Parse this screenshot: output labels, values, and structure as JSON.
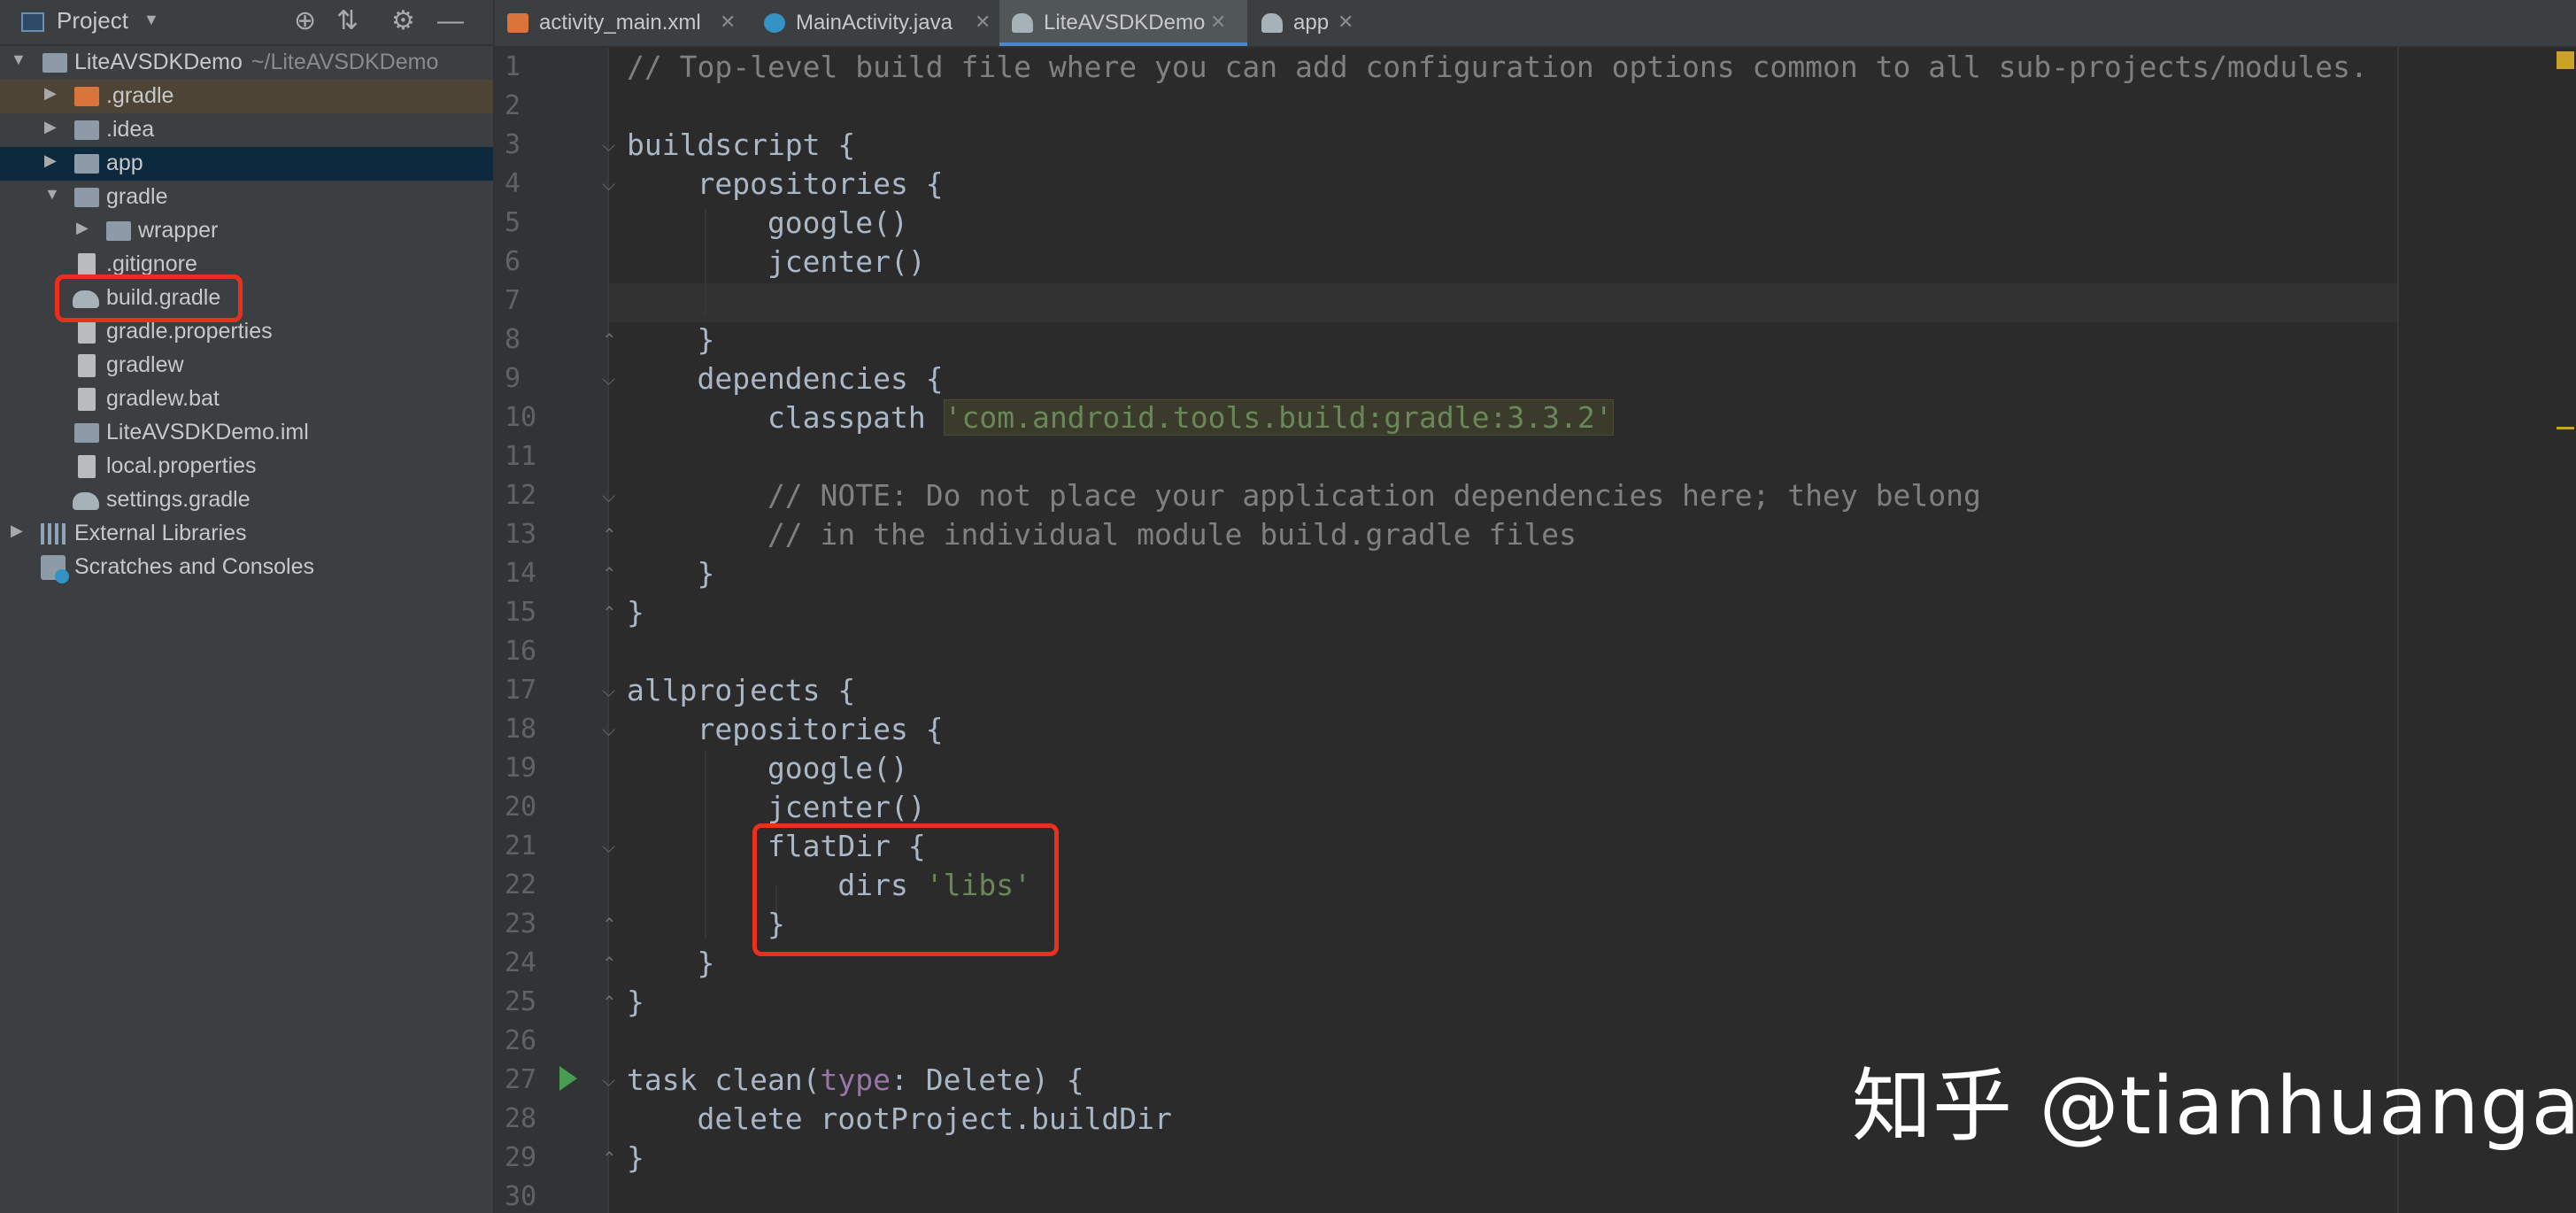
{
  "project_panel": {
    "title": "Project",
    "root": {
      "name": "LiteAVSDKDemo",
      "path": "~/LiteAVSDKDemo"
    },
    "items": [
      {
        "label": ".gradle"
      },
      {
        "label": ".idea"
      },
      {
        "label": "app"
      },
      {
        "label": "gradle"
      },
      {
        "label": "wrapper"
      },
      {
        "label": ".gitignore"
      },
      {
        "label": "build.gradle"
      },
      {
        "label": "gradle.properties"
      },
      {
        "label": "gradlew"
      },
      {
        "label": "gradlew.bat"
      },
      {
        "label": "LiteAVSDKDemo.iml"
      },
      {
        "label": "local.properties"
      },
      {
        "label": "settings.gradle"
      },
      {
        "label": "External Libraries"
      },
      {
        "label": "Scratches and Consoles"
      }
    ]
  },
  "tabs": [
    {
      "label": "activity_main.xml",
      "icon": "xml-file-icon"
    },
    {
      "label": "MainActivity.java",
      "icon": "java-class-icon"
    },
    {
      "label": "LiteAVSDKDemo",
      "icon": "gradle-icon",
      "active": true
    },
    {
      "label": "app",
      "icon": "gradle-icon"
    }
  ],
  "editor": {
    "line_numbers": [
      "1",
      "2",
      "3",
      "4",
      "5",
      "6",
      "7",
      "8",
      "9",
      "10",
      "11",
      "12",
      "13",
      "14",
      "15",
      "16",
      "17",
      "18",
      "19",
      "20",
      "21",
      "22",
      "23",
      "24",
      "25",
      "26",
      "27",
      "28",
      "29",
      "30"
    ],
    "lines": {
      "l1": "// Top-level build file where you can add configuration options common to all sub-projects/modules.",
      "l3": "buildscript {",
      "l4": "    repositories {",
      "l5": "        google()",
      "l6": "        jcenter()",
      "l8": "    }",
      "l9": "    dependencies {",
      "l10a": "        classpath ",
      "l10b": "'com.android.tools.build:gradle:3.3.2'",
      "l12": "        // NOTE: Do not place your application dependencies here; they belong",
      "l13": "        // in the individual module build.gradle files",
      "l14": "    }",
      "l15": "}",
      "l17": "allprojects {",
      "l18": "    repositories {",
      "l19": "        google()",
      "l20": "        jcenter()",
      "l21": "        flatDir {",
      "l22a": "            dirs ",
      "l22b": "'libs'",
      "l23": "        }",
      "l24": "    }",
      "l25": "}",
      "l27a": "task clean(",
      "l27b": "type",
      "l27c": ": Delete) {",
      "l28": "    delete rootProject.buildDir",
      "l29": "}"
    }
  },
  "watermark": "知乎 @tianhuanga",
  "colors": {
    "highlight_box": "#e8301c",
    "comment": "#808080",
    "string": "#6a8759",
    "keyword_param": "#9876aa",
    "code_text": "#a9b7c6"
  }
}
